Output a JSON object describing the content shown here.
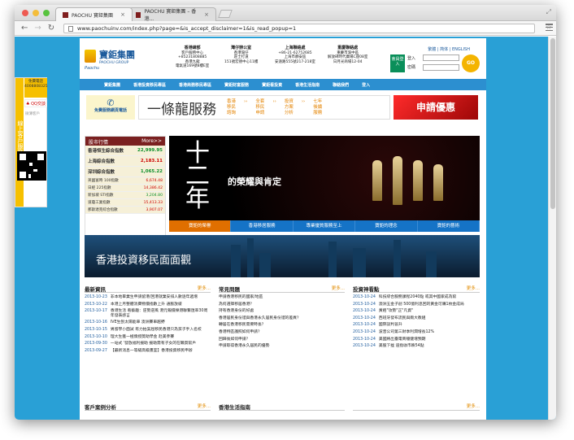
{
  "browser": {
    "tabs": [
      {
        "title": "PAOCHU 寶鉅集團"
      },
      {
        "title": "PAOCHU 寶鉅集團 – 香港..."
      }
    ],
    "url": "www.paochuinv.com/index.php?page=&is_accept_disclaimer=1&is_read_popup=1"
  },
  "colors": {
    "site_bg": "#29a0d6",
    "nav": "#2c8fd0",
    "accent": "#e48300",
    "brand": "#1b5a9c"
  },
  "side_float": {
    "vertical_label": "線上客戶服務熱線",
    "hotline_label": "免費電話",
    "hotline_number": "4008808325",
    "qq_label": "QQ交談",
    "weibo_label": "微薄客戶"
  },
  "header": {
    "logo_zh": "寶鉅集團",
    "logo_en": "PAOCHU GROUP",
    "logo_script": "Paochu",
    "offices": [
      {
        "title": "香港總部",
        "lines": [
          "客戶服務中心",
          "+85231808885",
          "香港九龍",
          "電氣道169號8樓E室"
        ]
      },
      {
        "title": "灣仔辦公室",
        "lines": [
          "香港灣仔",
          "莊士打道",
          "151號宏德中心11樓"
        ]
      },
      {
        "title": "上海聯絡處",
        "lines": [
          "+86-21-62752685",
          "上海市靜安區",
          "安遠路555號217-218室"
        ]
      },
      {
        "title": "重慶聯絡處",
        "lines": [
          "重慶市渝中區",
          "解放碑時代廣場C座08室",
          "日月光商場12-04"
        ]
      }
    ],
    "toplinks": "繁體 | 简体 | ENGLISH",
    "member_label": "會員登入",
    "login_label": "登入",
    "password_label": "密碼",
    "go_label": "GO"
  },
  "nav": [
    "寶鉅集團",
    "香港投資移民專區",
    "香港商務移民專區",
    "寶鉅財富服務",
    "寶鉅看投資",
    "香港生活指南",
    "聯絡我們",
    "登入"
  ],
  "promo": {
    "phone_label": "免費服務網頁電話",
    "one_stop": "一條龍服務",
    "steps": [
      {
        "top": "香港",
        "mid": "移民",
        "bot": "諮詢"
      },
      {
        "top": "全套",
        "mid": "移民",
        "bot": "申請"
      },
      {
        "top": "投資",
        "mid": "方案",
        "bot": "分析"
      },
      {
        "top": "七年",
        "mid": "後續",
        "bot": "服務"
      }
    ],
    "apply": "申請優惠"
  },
  "market": {
    "title": "股市行情",
    "more": "More>>",
    "rows": [
      {
        "name": "香港恒生綜合指數",
        "value": "22,999.95",
        "dir": "up"
      },
      {
        "name": "上海綜合指數",
        "value": "2,183.11",
        "dir": "dn"
      },
      {
        "name": "深圳綜合指數",
        "value": "1,065.22",
        "dir": "up"
      }
    ],
    "small_rows": [
      {
        "name": "英國富時 100指數",
        "value": "6,674.48",
        "dir": "dn"
      },
      {
        "name": "日經 225指數",
        "value": "14,386.42",
        "dir": "dn"
      },
      {
        "name": "新加坡 STI指數",
        "value": "3,204.80",
        "dir": "up"
      },
      {
        "name": "道瓊工業指數",
        "value": "15,413.33",
        "dir": "dn"
      },
      {
        "name": "那斯達克綜合指數",
        "value": "3,907.07",
        "dir": "dn"
      }
    ]
  },
  "hero": {
    "big": "十二年",
    "text": "的榮耀與肯定",
    "bar": [
      "寶鉅的榮譽",
      "香港移居服務",
      "專業優質服務至上",
      "寶鉅的理念",
      "寶鉅的藝術"
    ]
  },
  "city_banner": "香港投資移民面面觀",
  "news": {
    "title": "最新資訊",
    "more": "更多...",
    "items": [
      {
        "date": "2013-10-23",
        "text": "非本地畢業生申請留港/回港就業安排人數逐年遞增"
      },
      {
        "date": "2013-10-22",
        "text": "本港上月整體消費物價指數上升 通脹放緩"
      },
      {
        "date": "2013-10-17",
        "text": "香港生活 看藝趣：逆勢逆風 港元報價樂港聯繫匯率30周年發表感言"
      },
      {
        "date": "2013-10-16",
        "text": "IVE生刨太陽能車 澳洲賽車越野"
      },
      {
        "date": "2013-10-15",
        "text": "男留學小面試 有力拍案屈移民香港只為孩子手入名校"
      },
      {
        "date": "2013-10-10",
        "text": "理大生獲一極僑授獎助學金 赴美參賽"
      },
      {
        "date": "2013-09-30",
        "text": "一站式 '發放福利援助 援助需有子女的在職貧窮戶"
      },
      {
        "date": "2013-09-27",
        "text": "【最新消息—等級高級畫室】香港投資移民申辦"
      }
    ]
  },
  "faq": {
    "title": "常見問題",
    "more": "更多...",
    "items": [
      "申請香港移民的國家/地區",
      "為何選擇移居香港？",
      "持有香港身份的好處",
      "香港居民身份證與香港永久居民身份證的差異？",
      "轉居在香港移民需要時長？",
      "香港特區護照如何申請？",
      "回歸後如何申請？",
      "申請取得香港永久居民的優勢"
    ]
  },
  "invest": {
    "title": "投資神看點",
    "more": "更多...",
    "items": [
      {
        "date": "2013-10-24",
        "text": "科技綜合服務課程2040點 或其中國家成為窮"
      },
      {
        "date": "2013-10-24",
        "text": "澳洲五金子創 500億利息回的黃金可賺1枚金成局"
      },
      {
        "date": "2013-10-24",
        "text": "黃栢\"攻勢\"正\"凡資\""
      },
      {
        "date": "2013-10-24",
        "text": "西班牙發布流民與兩大教組"
      },
      {
        "date": "2013-10-24",
        "text": "國際談判晉升"
      },
      {
        "date": "2013-10-24",
        "text": "波音公司第三財季利潤增長12%"
      },
      {
        "date": "2013-10-24",
        "text": "美國將出臺電商穩健增預期"
      },
      {
        "date": "2013-10-24",
        "text": "美股下挫 道指收市跌54點"
      }
    ]
  },
  "bottom": {
    "left_title": "客戶案例分析",
    "left_more": "更多...",
    "mid_title": "香港生活指南",
    "right_more": "更多..."
  }
}
